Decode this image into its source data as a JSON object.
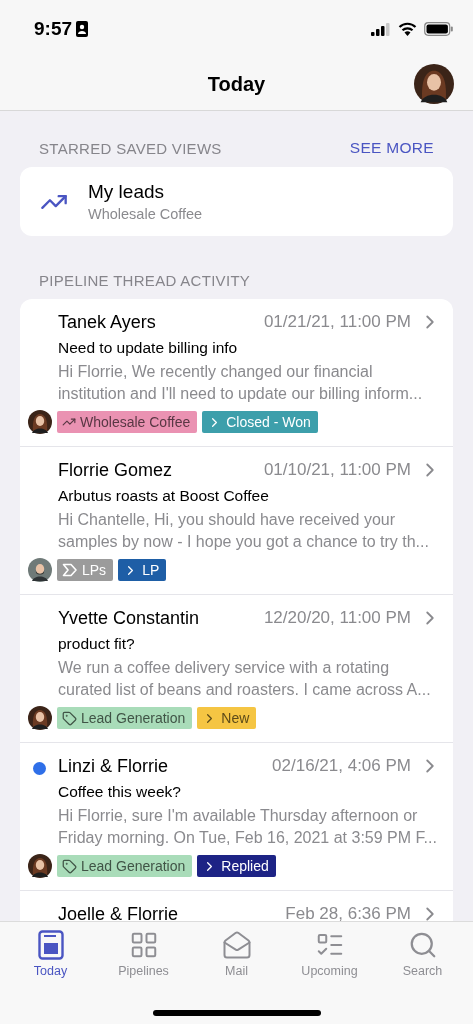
{
  "status_bar": {
    "time": "9:57"
  },
  "header": {
    "title": "Today"
  },
  "starred_views": {
    "heading": "STARRED SAVED VIEWS",
    "action": "SEE MORE",
    "items": [
      {
        "title": "My leads",
        "subtitle": "Wholesale Coffee"
      }
    ]
  },
  "activity": {
    "heading": "PIPELINE THREAD ACTIVITY",
    "threads": [
      {
        "name": "Tanek Ayers",
        "date": "01/21/21, 11:00 PM",
        "unread": false,
        "subject": "Need to update billing info",
        "preview": "Hi Florrie, We recently changed our financial institution and I'll need to update our billing inform...",
        "avatar": {
          "kind": "woman"
        },
        "tags": [
          {
            "kind": "view",
            "label": "Wholesale Coffee",
            "color": "#ea92b2"
          },
          {
            "kind": "stage",
            "label": "Closed - Won",
            "color": "#3d9fab"
          }
        ]
      },
      {
        "name": "Florrie Gomez",
        "date": "01/10/21, 11:00 PM",
        "unread": false,
        "subject": "Arbutus roasts at Boost Coffee",
        "preview": "Hi Chantelle, Hi, you should have received your samples by now - I hope you got a chance to try th...",
        "avatar": {
          "kind": "man"
        },
        "tags": [
          {
            "kind": "pipeline",
            "label": "LPs",
            "color": "#9b9b9b"
          },
          {
            "kind": "stage",
            "label": "LP",
            "color": "#1e5ea6"
          }
        ]
      },
      {
        "name": "Yvette Constantin",
        "date": "12/20/20, 11:00 PM",
        "unread": false,
        "subject": "product fit?",
        "preview": "We run a coffee delivery service with a rotating curated list of beans and roasters. I came across A...",
        "avatar": {
          "kind": "woman"
        },
        "tags": [
          {
            "kind": "tag",
            "label": "Lead Generation",
            "color": "#a9dcb9"
          },
          {
            "kind": "stage",
            "label": "New",
            "color": "#f5c543"
          }
        ]
      },
      {
        "name": "Linzi & Florrie",
        "date": "02/16/21, 4:06 PM",
        "unread": true,
        "subject": "Coffee this week?",
        "preview": "Hi Florrie, sure I'm available Thursday afternoon or Friday morning. On Tue, Feb 16, 2021 at 3:59 PM F...",
        "avatar": {
          "kind": "woman"
        },
        "tags": [
          {
            "kind": "tag",
            "label": "Lead Generation",
            "color": "#a9dcb9"
          },
          {
            "kind": "stage",
            "label": "Replied",
            "color": "#1d2385"
          }
        ]
      },
      {
        "name": "Joelle & Florrie",
        "date": "Feb 28, 6:36 PM",
        "unread": false
      }
    ]
  },
  "tab_bar": [
    {
      "label": "Today",
      "selected": true
    },
    {
      "label": "Pipelines",
      "selected": false
    },
    {
      "label": "Mail",
      "selected": false
    },
    {
      "label": "Upcoming",
      "selected": false
    },
    {
      "label": "Search",
      "selected": false
    }
  ]
}
